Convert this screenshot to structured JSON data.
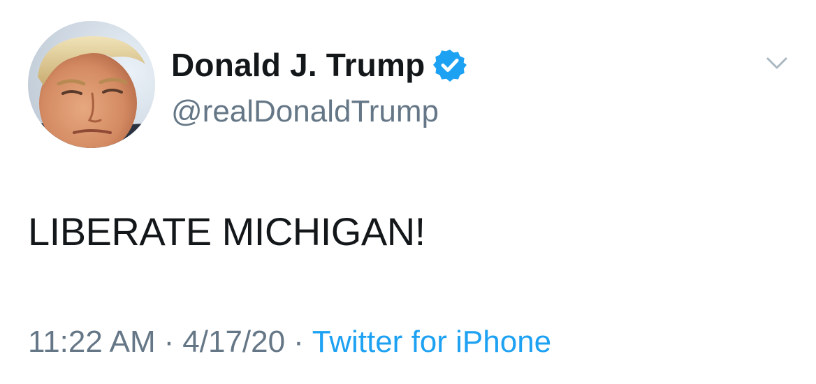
{
  "author": {
    "name": "Donald J. Trump",
    "handle": "@realDonaldTrump",
    "verified": true
  },
  "tweet": {
    "text": "LIBERATE MICHIGAN!"
  },
  "meta": {
    "time": "11:22 AM",
    "separator": "·",
    "date": "4/17/20",
    "source": "Twitter for iPhone"
  },
  "icons": {
    "avatar": "avatar-photo",
    "verified": "verified-badge-icon",
    "menu": "chevron-down-icon"
  },
  "colors": {
    "text_primary": "#14171a",
    "text_secondary": "#657786",
    "accent": "#1da1f2",
    "chevron": "#aab8c2"
  }
}
